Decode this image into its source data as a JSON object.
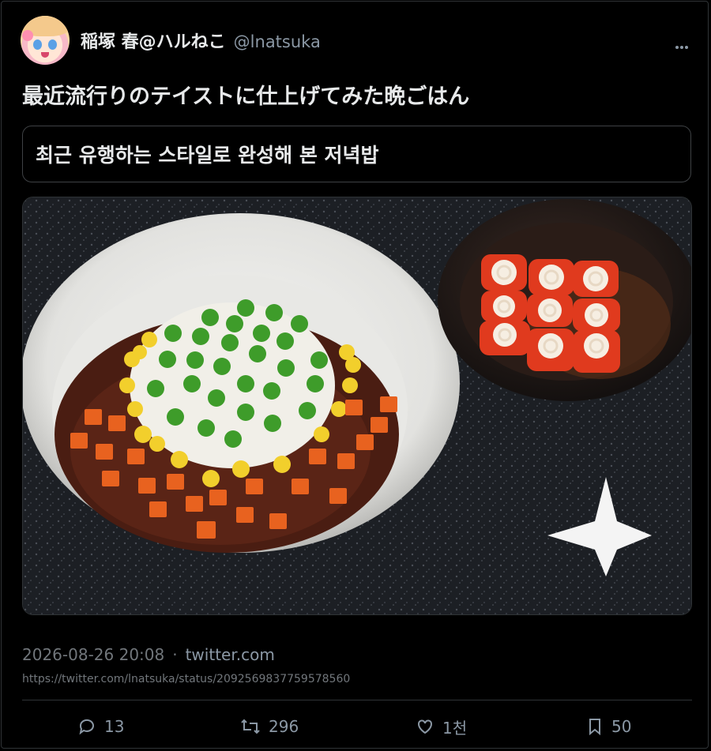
{
  "post": {
    "display_name": "稲塚 春@ハルねこ",
    "handle": "@lnatsuka",
    "more_icon": "more-dots-icon",
    "text": "最近流行りのテイストに仕上げてみた晩ごはん",
    "translation": "최근 유행하는 스타일로 완성해 본 저녁밥",
    "timestamp": "2026-08-26 20:08",
    "separator": "·",
    "source": "twitter.com",
    "url": "https://twitter.com/lnatsuka/status/2092569837759578560"
  },
  "actions": {
    "replies": "13",
    "retweets": "296",
    "likes": "1천",
    "bookmarks": "50"
  },
  "colors": {
    "background": "#000000",
    "text": "#e7e9ea",
    "muted": "#71767b",
    "border": "#2f3336"
  }
}
